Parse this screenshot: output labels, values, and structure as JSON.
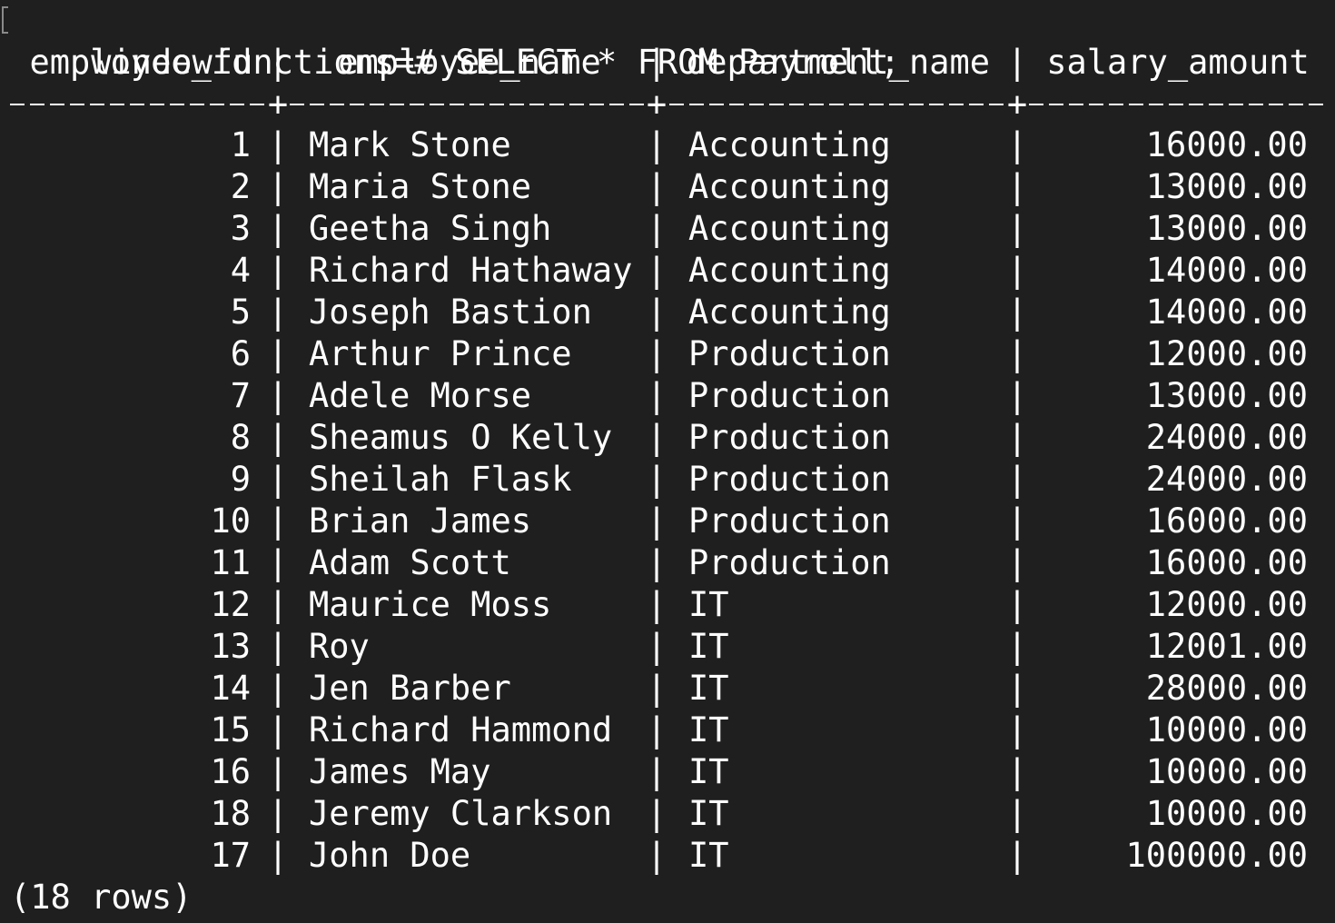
{
  "terminal": {
    "prompt": "windowfunctions=#",
    "command": " SELECT * FROM Payroll;"
  },
  "result": {
    "columns": [
      "employee_id",
      "employee_name",
      "department_name",
      "salary_amount"
    ],
    "rows": [
      {
        "employee_id": "1",
        "employee_name": "Mark Stone",
        "department_name": "Accounting",
        "salary_amount": "16000.00"
      },
      {
        "employee_id": "2",
        "employee_name": "Maria Stone",
        "department_name": "Accounting",
        "salary_amount": "13000.00"
      },
      {
        "employee_id": "3",
        "employee_name": "Geetha Singh",
        "department_name": "Accounting",
        "salary_amount": "13000.00"
      },
      {
        "employee_id": "4",
        "employee_name": "Richard Hathaway",
        "department_name": "Accounting",
        "salary_amount": "14000.00"
      },
      {
        "employee_id": "5",
        "employee_name": "Joseph Bastion",
        "department_name": "Accounting",
        "salary_amount": "14000.00"
      },
      {
        "employee_id": "6",
        "employee_name": "Arthur Prince",
        "department_name": "Production",
        "salary_amount": "12000.00"
      },
      {
        "employee_id": "7",
        "employee_name": "Adele Morse",
        "department_name": "Production",
        "salary_amount": "13000.00"
      },
      {
        "employee_id": "8",
        "employee_name": "Sheamus O Kelly",
        "department_name": "Production",
        "salary_amount": "24000.00"
      },
      {
        "employee_id": "9",
        "employee_name": "Sheilah Flask",
        "department_name": "Production",
        "salary_amount": "24000.00"
      },
      {
        "employee_id": "10",
        "employee_name": "Brian James",
        "department_name": "Production",
        "salary_amount": "16000.00"
      },
      {
        "employee_id": "11",
        "employee_name": "Adam Scott",
        "department_name": "Production",
        "salary_amount": "16000.00"
      },
      {
        "employee_id": "12",
        "employee_name": "Maurice Moss",
        "department_name": "IT",
        "salary_amount": "12000.00"
      },
      {
        "employee_id": "13",
        "employee_name": "Roy",
        "department_name": "IT",
        "salary_amount": "12001.00"
      },
      {
        "employee_id": "14",
        "employee_name": "Jen Barber",
        "department_name": "IT",
        "salary_amount": "28000.00"
      },
      {
        "employee_id": "15",
        "employee_name": "Richard Hammond",
        "department_name": "IT",
        "salary_amount": "10000.00"
      },
      {
        "employee_id": "16",
        "employee_name": "James May",
        "department_name": "IT",
        "salary_amount": "10000.00"
      },
      {
        "employee_id": "18",
        "employee_name": "Jeremy Clarkson",
        "department_name": "IT",
        "salary_amount": "10000.00"
      },
      {
        "employee_id": "17",
        "employee_name": "John Doe",
        "department_name": "IT",
        "salary_amount": "100000.00"
      }
    ],
    "row_count": "(18 rows)"
  },
  "colors": {
    "background": "#1f1f1f",
    "text": "#ffffff"
  }
}
